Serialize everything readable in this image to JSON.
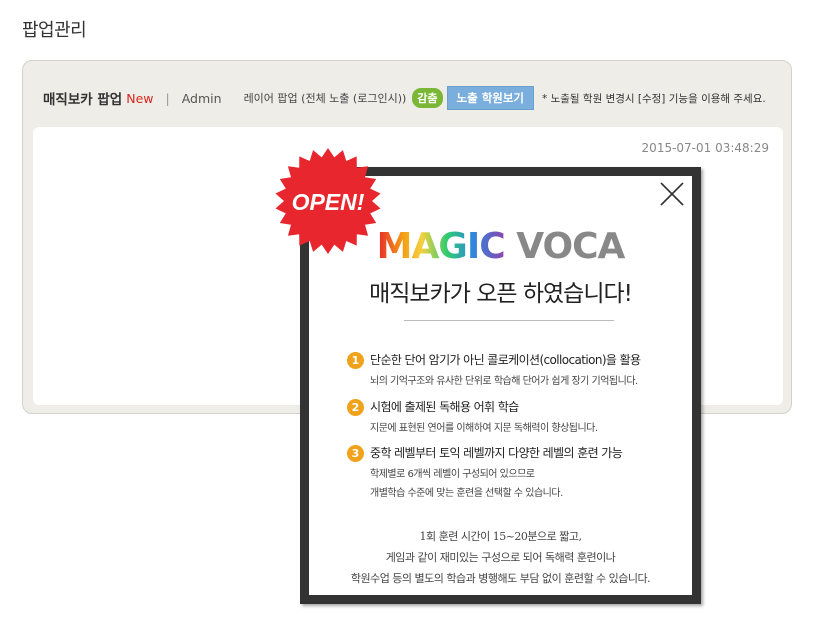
{
  "page": {
    "title": "팝업관리"
  },
  "panel": {
    "popup_name": "매직보카 팝업",
    "new_label": "New",
    "separator": "|",
    "author": "Admin",
    "layer_info": "레이어 팝업  (전체 노출 (로그인시))",
    "hide_badge": "감춤",
    "view_button": "노출 학원보기",
    "note": "* 노출될 학원 변경시 [수정] 기능을 이용해 주세요.",
    "timestamp": "2015-07-01 03:48:29"
  },
  "popup": {
    "burst_text": "OPEN!",
    "logo": {
      "magic": "MAGIC",
      "voca": "VOCA"
    },
    "headline": "매직보카가 오픈 하였습니다!",
    "features": [
      {
        "num": "1",
        "title": "단순한 단어 암기가 아닌 콜로케이션(collocation)을 활용",
        "desc": [
          "뇌의 기억구조와 유사한 단위로 학습해 단어가 쉽게 장기 기억됩니다."
        ]
      },
      {
        "num": "2",
        "title": "시험에 출제된 독해용 어휘 학습",
        "desc": [
          "지문에 표현된 연어를 이해하여 지문 독해력이 향상됩니다."
        ]
      },
      {
        "num": "3",
        "title": "중학 레벨부터 토익 레벨까지 다양한 레벨의 훈련 가능",
        "desc": [
          "학제별로 6개씩 레벨이 구성되어 있으므로",
          "개별학습 수준에 맞는 훈련을 선택할 수 있습니다."
        ]
      }
    ],
    "summary": [
      "1회 훈련 시간이 15~20분으로 짧고,",
      "게임과 같이 재미있는 구성으로 되어 독해력 훈련이나",
      "학원수업 등의 별도의 학습과 병행해도 부담 없이 훈련할 수 있습니다."
    ]
  },
  "colors": {
    "accent_new": "#d9261c",
    "hide_badge": "#7bb737",
    "view_button": "#7aaedd",
    "number_badge": "#f0a21b",
    "burst": "#e8262d"
  },
  "icons": {
    "close": "close-x-icon"
  }
}
